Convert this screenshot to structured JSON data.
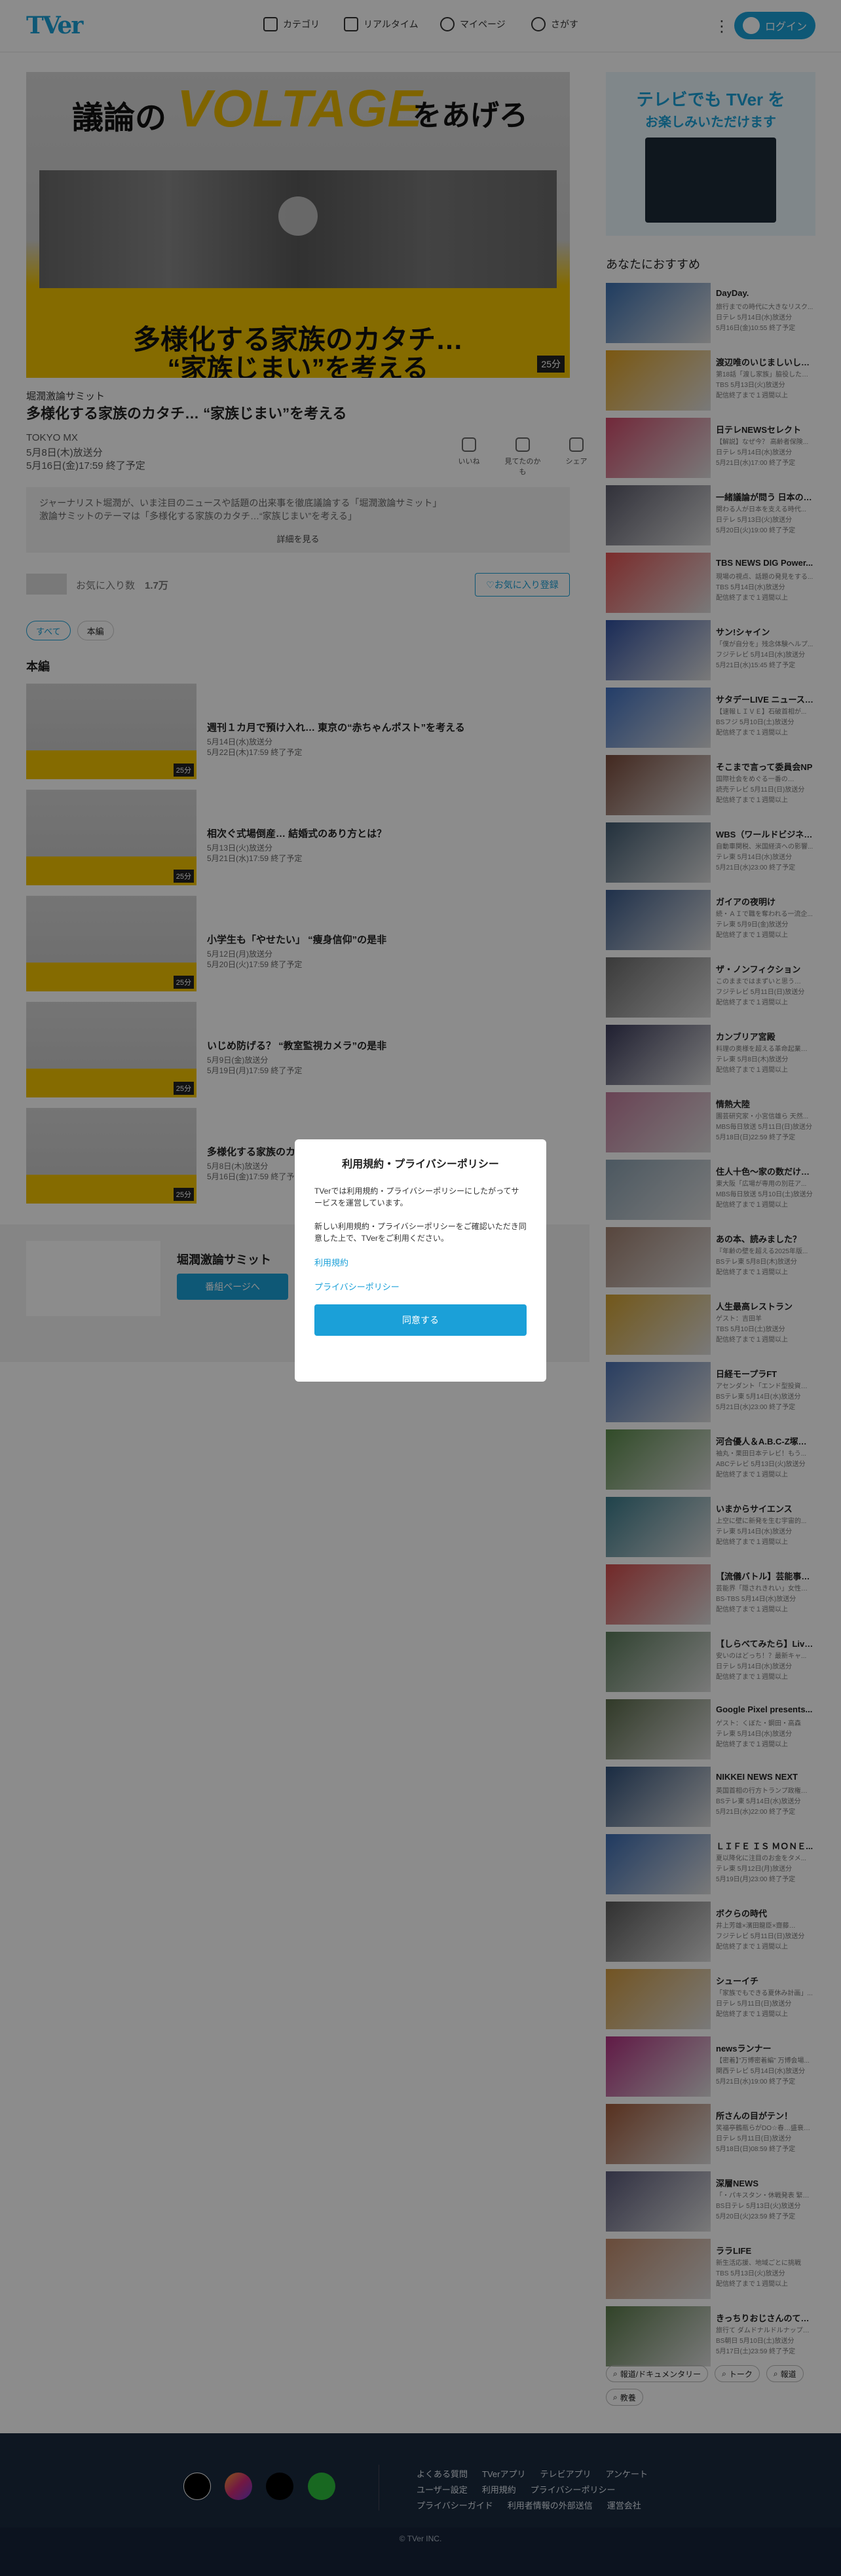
{
  "header": {
    "logo": "TVer",
    "nav": [
      "カテゴリ",
      "リアルタイム",
      "マイページ",
      "さがす"
    ],
    "login": "ログイン"
  },
  "hero": {
    "line1": "議論の",
    "line2": "VOLTAGE",
    "line3": "をあげろ",
    "caption1": "多様化する家族のカタチ…",
    "caption2": "“家族じまい”を考える",
    "duration": "25分"
  },
  "episode": {
    "program": "堀潤激論サミット",
    "title": "多様化する家族のカタチ… “家族じまい”を考える",
    "broadcaster": "TOKYO MX",
    "aired": "5月8日(木)放送分",
    "expires": "5月16日(金)17:59 終了予定",
    "actions": [
      "いいね",
      "見てたのかも",
      "シェア"
    ],
    "description1": "ジャーナリスト堀潤が、いま注目のニュースや話題の出来事を徹底議論する「堀潤激論サミット」",
    "description2": "激論サミットのテーマは「多様化する家族のカタチ…“家族じまい”を考える」",
    "more": "詳細を見る",
    "favorites_label": "お気に入り数",
    "favorites_count": "1.7万",
    "favorite_button": "お気に入り登録"
  },
  "filters": [
    "すべて",
    "本編"
  ],
  "section_title": "本編",
  "episodes": [
    {
      "title": "週刊１カ月で預け入れ… 東京の“赤ちゃんポスト”を考える",
      "aired": "5月14日(水)放送分",
      "expires": "5月22日(木)17:59 終了予定",
      "duration": "25分"
    },
    {
      "title": "相次ぐ式場倒産… 結婚式のあり方とは？",
      "aired": "5月13日(火)放送分",
      "expires": "5月21日(水)17:59 終了予定",
      "duration": "25分"
    },
    {
      "title": "小学生も「やせたい」 “痩身信仰”の是非",
      "aired": "5月12日(月)放送分",
      "expires": "5月20日(火)17:59 終了予定",
      "duration": "25分"
    },
    {
      "title": "いじめ防げる？ “教室監視カメラ”の是非",
      "aired": "5月9日(金)放送分",
      "expires": "5月19日(月)17:59 終了予定",
      "duration": "25分"
    },
    {
      "title": "多様化する家族のカタチ… “家族じまい”を考える",
      "aired": "5月8日(木)放送分",
      "expires": "5月16日(金)17:59 終了予定",
      "duration": "25分"
    }
  ],
  "series_card": {
    "name": "堀潤激論サミット",
    "button": "番組ページへ"
  },
  "sidebar": {
    "banner_line1": "テレビでも TVer を",
    "banner_line2": "お楽しみいただけます",
    "rec_title": "あなたにおすすめ",
    "items": [
      {
        "title": "DayDay.",
        "sub": "旅行までの時代に大きなリスク...",
        "line": "日テレ 5月14日(水)放送分",
        "exp": "5月16日(金)10:55 終了予定",
        "color": "#3a6fb0"
      },
      {
        "title": "渡辺唯のいじましいしたタカシ",
        "sub": "第18話「渡し家族」脇役した…",
        "line": "TBS 5月13日(火)放送分",
        "exp": "配信終了まで１週間以上",
        "color": "#e0a020"
      },
      {
        "title": "日テレNEWSセレクト",
        "sub": "【解説】なぜ今？ 高齢者保険...",
        "line": "日テレ 5月14日(水)放送分",
        "exp": "5月21日(水)17:00 終了予定",
        "color": "#cf4a6a"
      },
      {
        "title": "一緒議論が問う 日本の未来",
        "sub": "関わる人が日本を支える時代...",
        "line": "日テレ 5月13日(火)放送分",
        "exp": "5月20日(火)19:00 終了予定",
        "color": "#5a5a6a"
      },
      {
        "title": "TBS NEWS DIG Power...",
        "sub": "現場の視点、話題の発見をする...",
        "line": "TBS 5月14日(水)放送分",
        "exp": "配信終了まで１週間以上",
        "color": "#e05050"
      },
      {
        "title": "サン!シャイン",
        "sub": "「僕が自分を」残念体験ヘルプ...",
        "line": "フジテレビ 5月14日(水)放送分",
        "exp": "5月21日(水)15:45 終了予定",
        "color": "#3050a0"
      },
      {
        "title": "サタデーLIVE ニュース ジ...",
        "sub": "【速報ＬＩＶＥ】石破首相が...",
        "line": "BSフジ 5月10日(土)放送分",
        "exp": "配信終了まで１週間以上",
        "color": "#4070c0"
      },
      {
        "title": "そこまで言って委員会NP",
        "sub": "国際社会をめぐる一番の…",
        "line": "読売テレビ 5月11日(日)放送分",
        "exp": "配信終了まで１週間以上",
        "color": "#7a4a3a"
      },
      {
        "title": "WBS（ワールドビジネス...",
        "sub": "自動車関税、米国経済への影響...",
        "line": "テレ東 5月14日(水)放送分",
        "exp": "5月21日(水)23:00 終了予定",
        "color": "#405a70"
      },
      {
        "title": "ガイアの夜明け",
        "sub": "続・ＡＩで職を奪われる一流企...",
        "line": "テレ東 5月9日(金)放送分",
        "exp": "配信終了まで１週間以上",
        "color": "#3a5a8a"
      },
      {
        "title": "ザ・ノンフィクション",
        "sub": "このままではまずいと思う…",
        "line": "フジテレビ 5月11日(日)放送分",
        "exp": "配信終了まで１週間以上",
        "color": "#6a6a6a"
      },
      {
        "title": "カンブリア宮殿",
        "sub": "料理の奥様を超える革命起業…",
        "line": "テレ東 5月8日(木)放送分",
        "exp": "配信終了まで１週間以上",
        "color": "#3a3a5a"
      },
      {
        "title": "情熱大陸",
        "sub": "園芸研究家・小宮信雄ら 天然...",
        "line": "MBS毎日放送 5月11日(日)放送分",
        "exp": "5月18日(日)22:59 終了予定",
        "color": "#c07a9a"
      },
      {
        "title": "住人十色～家の数だけある...",
        "sub": "東大阪「広場が専用の別荘ア...",
        "line": "MBS毎日放送 5月10日(土)放送分",
        "exp": "配信終了まで１週間以上",
        "color": "#8aa0b0"
      },
      {
        "title": "あの本、読みました？",
        "sub": "『年齢の壁を超える2025年版...",
        "line": "BSテレ東 5月8日(木)放送分",
        "exp": "配信終了まで１週間以上",
        "color": "#a08070"
      },
      {
        "title": "人生最高レストラン",
        "sub": "ゲスト：吉田羊",
        "line": "TBS 5月10日(土)放送分",
        "exp": "配信終了まで１週間以上",
        "color": "#d0a030"
      },
      {
        "title": "日経モープラFT",
        "sub": "アセンダント「エンド型投資…",
        "line": "BSテレ東 5月14日(水)放送分",
        "exp": "5月21日(水)23:00 終了予定",
        "color": "#4a70b0"
      },
      {
        "title": "河合優人＆A.B.C-Z塚田＆...",
        "sub": "袖丸・栗田日本テレビ！もう...",
        "line": "ABCテレビ 5月13日(火)放送分",
        "exp": "配信終了まで１週間以上",
        "color": "#5a8a4a"
      },
      {
        "title": "いまからサイエンス",
        "sub": "上空に壁に新発を生む宇宙的...",
        "line": "テレ東 5月14日(水)放送分",
        "exp": "配信終了まで１週間以上",
        "color": "#3a7a8a"
      },
      {
        "title": "【流儀バトル】芸能事件ー芸...",
        "sub": "芸能界「隠されきれい」女性…",
        "line": "BS-TBS 5月14日(水)放送分",
        "exp": "配信終了まで１週間以上",
        "color": "#d04a4a"
      },
      {
        "title": "【しらべてみたら】Live ...",
        "sub": "安いのはどっち！？最新キャ...",
        "line": "日テレ 5月14日(水)放送分",
        "exp": "配信終了まで１週間以上",
        "color": "#5a7a5a"
      },
      {
        "title": "Google Pixel presents...",
        "sub": "ゲスト：くぼた・鋼田・高森",
        "line": "テレ東 5月14日(水)放送分",
        "exp": "配信終了まで１週間以上",
        "color": "#5a6a4a"
      },
      {
        "title": "NIKKEI NEWS NEXT",
        "sub": "英国首相の行方トランプ政権…",
        "line": "BSテレ東 5月14日(水)放送分",
        "exp": "5月21日(水)22:00 終了予定",
        "color": "#30507a"
      },
      {
        "title": "ＬＩＦＥ ＩＳ ＭＯＮＥ...",
        "sub": "夏以降化に注目のお金をタメ...",
        "line": "テレ東 5月12日(月)放送分",
        "exp": "5月19日(月)23:00 終了予定",
        "color": "#3a6ab0"
      },
      {
        "title": "ボクらの時代",
        "sub": "井上芳雄×濱田龍臣×齋藤…",
        "line": "フジテレビ 5月11日(日)放送分",
        "exp": "配信終了まで１週間以上",
        "color": "#5a5a5a"
      },
      {
        "title": "シューイチ",
        "sub": "「家族でもできる夏休み計画」...",
        "line": "日テレ 5月11日(日)放送分",
        "exp": "配信終了まで１週間以上",
        "color": "#d09a40"
      },
      {
        "title": "newsランナー",
        "sub": "【密着】”万博密着編” 万博会場...",
        "line": "関西テレビ 5月14日(水)放送分",
        "exp": "5月21日(水)19:00 終了予定",
        "color": "#b03080"
      },
      {
        "title": "所さんの目がテン！",
        "sub": "笑福亭鶴瓶らがDO☆春…盛衰の...",
        "line": "日テレ 5月11日(日)放送分",
        "exp": "5月18日(日)08:59 終了予定",
        "color": "#a05a3a"
      },
      {
        "title": "深層NEWS",
        "sub": "「・パキスタン・休戦発表 緊張...",
        "line": "BS日テレ 5月13日(火)放送分",
        "exp": "5月20日(火)23:59 終了予定",
        "color": "#5a5a7a"
      },
      {
        "title": "ララLIFE",
        "sub": "新生活応援、地域ごとに挑戦",
        "line": "TBS 5月13日(火)放送分",
        "exp": "配信終了まで１週間以上",
        "color": "#c08a6a"
      },
      {
        "title": "きっちりおじさんのてんや...",
        "sub": "旅行て ダムドナルドルナップ…",
        "line": "BS朝日 5月10日(土)放送分",
        "exp": "5月17日(土)23:59 終了予定",
        "color": "#5a7a4a"
      }
    ],
    "tags": [
      "報道/ドキュメンタリー",
      "トーク",
      "報道",
      "教養"
    ]
  },
  "footer": {
    "links_row1": [
      "よくある質問",
      "TVerアプリ",
      "テレビアプリ",
      "アンケート"
    ],
    "links_row2": [
      "ユーザー設定",
      "利用規約",
      "プライバシーポリシー"
    ],
    "links_row3": [
      "プライバシーガイド",
      "利用者情報の外部送信",
      "運営会社"
    ],
    "copyright": "© TVer INC."
  },
  "modal": {
    "title": "利用規約・プライバシーポリシー",
    "text1": "TVerでは利用規約・プライバシーポリシーにしたがってサービスを運営しています。",
    "text2": "新しい利用規約・プライバシーポリシーをご確認いただき同意した上で、TVerをご利用ください。",
    "link1": "利用規約",
    "link2": "プライバシーポリシー",
    "agree": "同意する"
  }
}
